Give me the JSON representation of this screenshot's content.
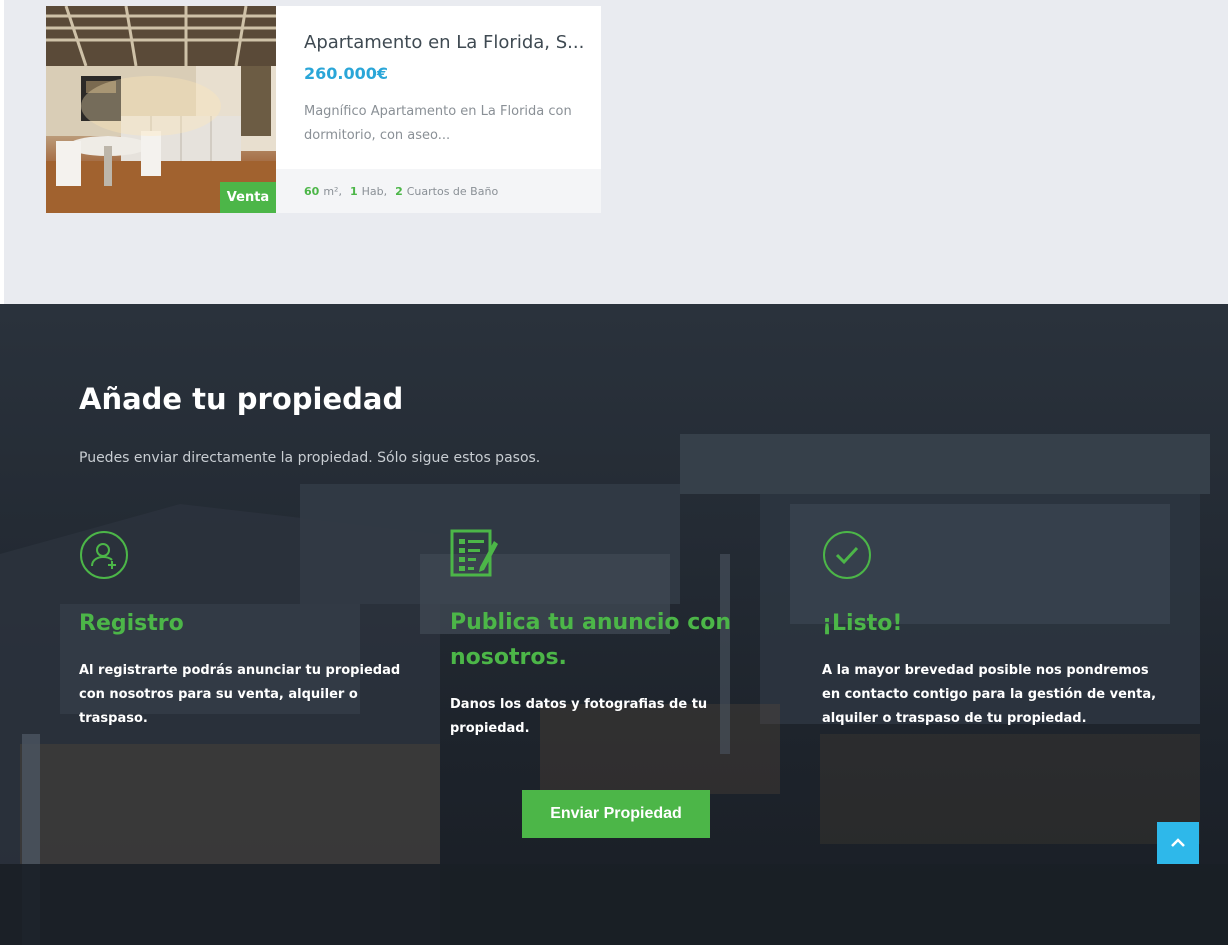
{
  "listing": {
    "title": "Apartamento en La Florida, S...",
    "price": "260.000€",
    "description": "Magnífico Apartamento en La Florida con dormitorio, con aseo...",
    "badge": "Venta",
    "area_value": "60",
    "area_unit": "m²,",
    "rooms_value": "1",
    "rooms_label": "Hab,",
    "baths_value": "2",
    "baths_label": "Cuartos de Baño"
  },
  "add_property": {
    "title": "Añade tu propiedad",
    "subtitle": "Puedes enviar directamente la propiedad. Sólo sigue estos pasos.",
    "steps": [
      {
        "icon": "user-plus-icon",
        "title": "Registro",
        "text": "Al registrarte podrás anunciar tu propiedad con nosotros para su venta, alquiler o traspaso."
      },
      {
        "icon": "edit-document-icon",
        "title": "Publica tu anuncio con nosotros.",
        "text": "Danos los datos y fotografias de tu propiedad."
      },
      {
        "icon": "check-circle-icon",
        "title": "¡Listo!",
        "text": "A la mayor brevedad posible nos pondremos en contacto contigo para la gestión de venta, alquiler o traspaso de tu propiedad."
      }
    ],
    "button_label": "Enviar Propiedad"
  },
  "colors": {
    "accent_green": "#4cb648",
    "price_blue": "#2aa6d8",
    "scroll_top_blue": "#2eb8ea"
  }
}
